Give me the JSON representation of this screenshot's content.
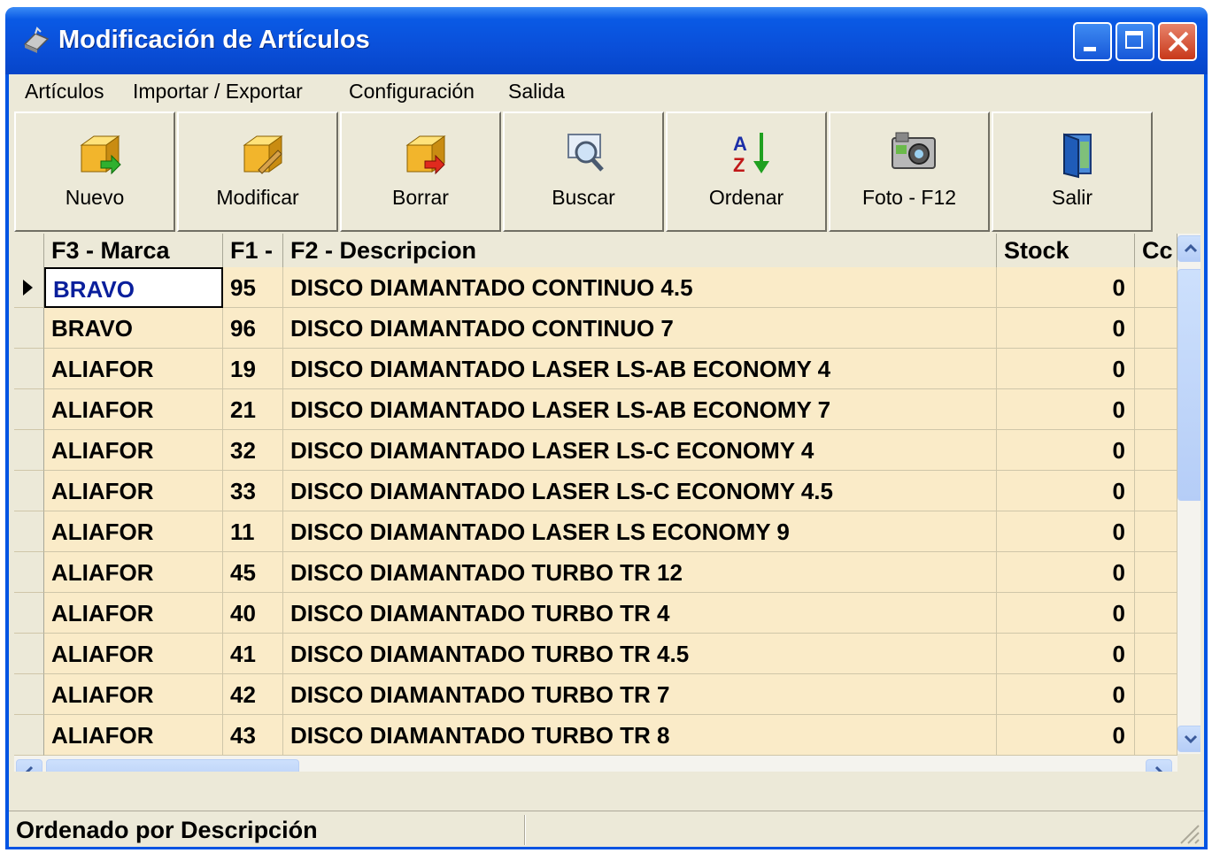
{
  "window": {
    "title": "Modificación de Artículos"
  },
  "menu": [
    "Artículos",
    "Importar / Exportar",
    "Configuración",
    "Salida"
  ],
  "toolbar": [
    {
      "label": "Nuevo",
      "icon": "new-box-icon"
    },
    {
      "label": "Modificar",
      "icon": "edit-box-icon"
    },
    {
      "label": "Borrar",
      "icon": "delete-box-icon"
    },
    {
      "label": "Buscar",
      "icon": "search-icon"
    },
    {
      "label": "Ordenar",
      "icon": "sort-az-icon"
    },
    {
      "label": "Foto - F12",
      "icon": "camera-icon"
    },
    {
      "label": "Salir",
      "icon": "exit-door-icon"
    }
  ],
  "grid": {
    "columns": [
      "F3 - Marca",
      "F1 -",
      "F2 - Descripcion",
      "Stock",
      "Cc"
    ],
    "rows": [
      {
        "marca": "BRAVO",
        "code": "95",
        "desc": "DISCO DIAMANTADO CONTINUO 4.5",
        "stock": "0"
      },
      {
        "marca": "BRAVO",
        "code": "96",
        "desc": "DISCO DIAMANTADO CONTINUO 7",
        "stock": "0"
      },
      {
        "marca": "ALIAFOR",
        "code": "19",
        "desc": "DISCO DIAMANTADO LASER LS-AB ECONOMY 4",
        "stock": "0"
      },
      {
        "marca": "ALIAFOR",
        "code": "21",
        "desc": "DISCO DIAMANTADO LASER LS-AB ECONOMY 7",
        "stock": "0"
      },
      {
        "marca": "ALIAFOR",
        "code": "32",
        "desc": "DISCO DIAMANTADO LASER LS-C ECONOMY 4",
        "stock": "0"
      },
      {
        "marca": "ALIAFOR",
        "code": "33",
        "desc": "DISCO DIAMANTADO LASER LS-C ECONOMY 4.5",
        "stock": "0"
      },
      {
        "marca": "ALIAFOR",
        "code": "11",
        "desc": "DISCO DIAMANTADO LASER LS ECONOMY 9",
        "stock": "0"
      },
      {
        "marca": "ALIAFOR",
        "code": "45",
        "desc": "DISCO DIAMANTADO TURBO TR 12",
        "stock": "0"
      },
      {
        "marca": "ALIAFOR",
        "code": "40",
        "desc": "DISCO DIAMANTADO TURBO TR 4",
        "stock": "0"
      },
      {
        "marca": "ALIAFOR",
        "code": "41",
        "desc": "DISCO DIAMANTADO TURBO TR 4.5",
        "stock": "0"
      },
      {
        "marca": "ALIAFOR",
        "code": "42",
        "desc": "DISCO DIAMANTADO TURBO TR 7",
        "stock": "0"
      },
      {
        "marca": "ALIAFOR",
        "code": "43",
        "desc": "DISCO DIAMANTADO TURBO TR 8",
        "stock": "0"
      }
    ]
  },
  "status": {
    "text": "Ordenado por Descripción",
    "second": ""
  },
  "colors": {
    "titlebar": "#0a4fd9",
    "grid_bg": "#faebc8",
    "selected_text": "#0a1f9c"
  }
}
